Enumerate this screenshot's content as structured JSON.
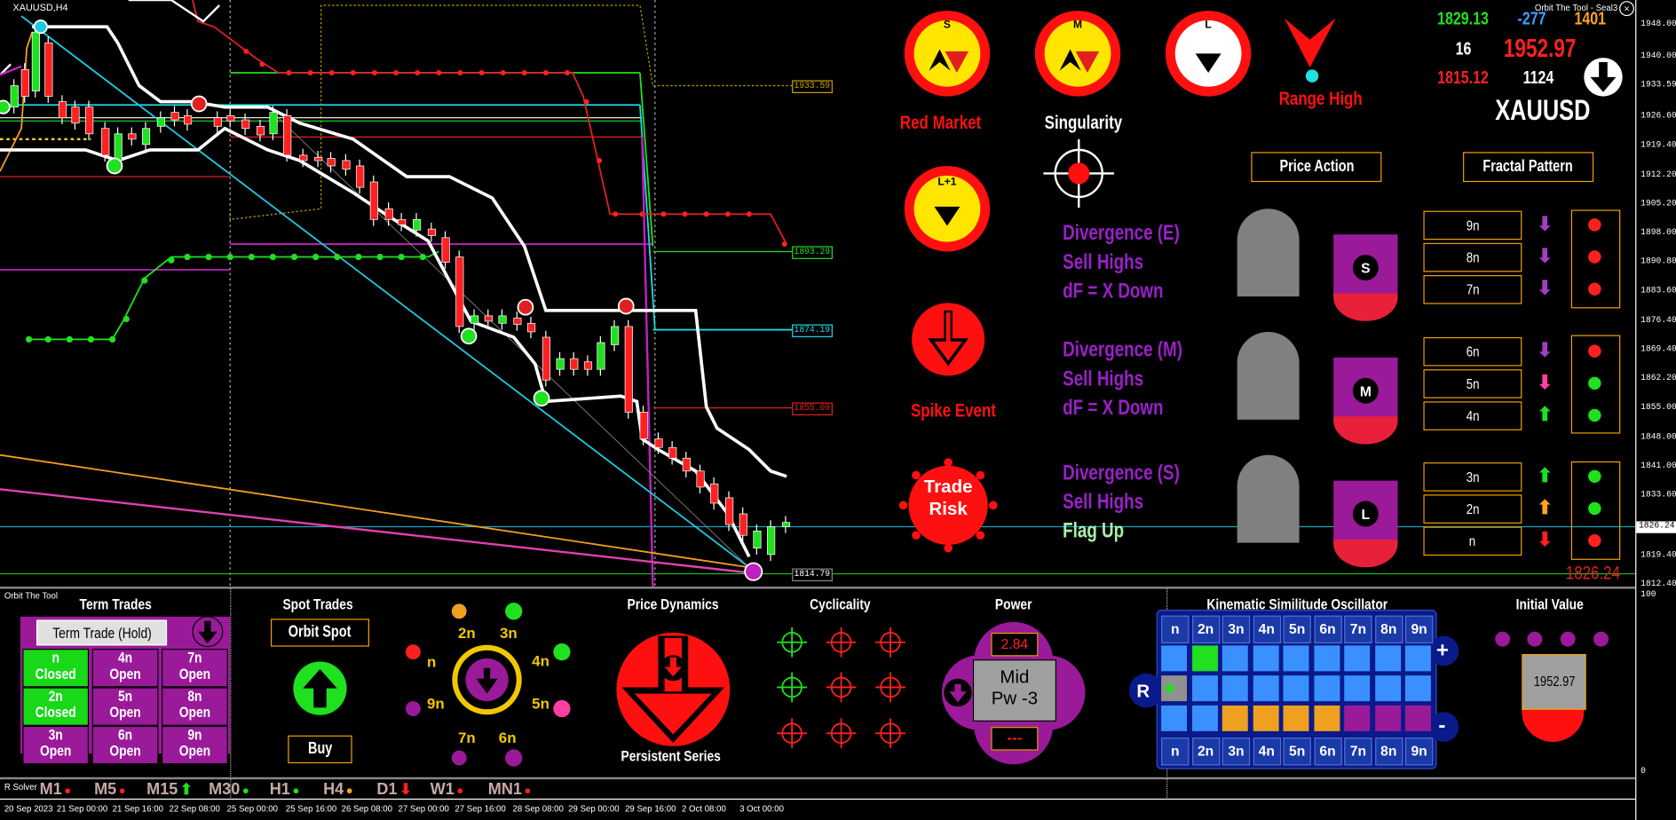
{
  "window": {
    "symbol_title": "XAUUSD,H4",
    "indicator_title": "Orbit The Tool - Seal3",
    "panel_title": "Orbit The Tool",
    "solver_label": "R Solver"
  },
  "top_stats": {
    "v1": "1829.13",
    "v2": "-277",
    "v3": "1401",
    "v4": "16",
    "v5": "1952.97",
    "v6": "1815.12",
    "v7": "1124",
    "symbol": "XAUUSD"
  },
  "price_axis": {
    "labels": [
      "1948.00",
      "1940.00",
      "1933.59",
      "1926.60",
      "1919.40",
      "1912.20",
      "1905.20",
      "1898.00",
      "1890.80",
      "1883.60",
      "1876.40",
      "1869.40",
      "1862.20",
      "1855.00",
      "1848.00",
      "1841.00",
      "1833.60",
      "1826.24",
      "1819.40",
      "1812.40"
    ],
    "current": "1826.24",
    "osc_top": "100",
    "osc_bottom": "0"
  },
  "levels": {
    "l1": "1933.59",
    "l2": "1893.29",
    "l3": "1874.19",
    "l4": "1855.09",
    "l5": "1814.79",
    "current_big": "1826.24"
  },
  "markets": {
    "s_letter": "S",
    "m_letter": "M",
    "l_letter": "L",
    "lplus_letter": "L+1",
    "red_market": "Red Market",
    "singularity": "Singularity",
    "range_high": "Range High",
    "spike_event": "Spike Event",
    "trade_risk_1": "Trade",
    "trade_risk_2": "Risk"
  },
  "divergence": [
    {
      "title": "Divergence (E)",
      "line2": "Sell Highs",
      "line3": "dF = X Down"
    },
    {
      "title": "Divergence (M)",
      "line2": "Sell Highs",
      "line3": "dF = X Down"
    },
    {
      "title": "Divergence (S)",
      "line2": "Sell Highs",
      "line3": "Flag Up"
    }
  ],
  "buttons": {
    "price_action": "Price Action",
    "fractal_pattern": "Fractal Pattern"
  },
  "fractal_rows": [
    {
      "label": "9n",
      "arrow": "⬇",
      "arrow_color": "#a040c0",
      "dot": "#ff2020"
    },
    {
      "label": "8n",
      "arrow": "⬇",
      "arrow_color": "#a040c0",
      "dot": "#ff2020"
    },
    {
      "label": "7n",
      "arrow": "⬇",
      "arrow_color": "#a040c0",
      "dot": "#ff2020"
    },
    {
      "label": "6n",
      "arrow": "⬇",
      "arrow_color": "#a040c0",
      "dot": "#ff2020"
    },
    {
      "label": "5n",
      "arrow": "⬇",
      "arrow_color": "#ff40a0",
      "dot": "#20e020"
    },
    {
      "label": "4n",
      "arrow": "⬆",
      "arrow_color": "#20e020",
      "dot": "#20e020"
    },
    {
      "label": "3n",
      "arrow": "⬆",
      "arrow_color": "#20e020",
      "dot": "#20e020"
    },
    {
      "label": "2n",
      "arrow": "⬆",
      "arrow_color": "#ffa020",
      "dot": "#20e020"
    },
    {
      "label": "n",
      "arrow": "⬇",
      "arrow_color": "#ff2020",
      "dot": "#ff2020"
    }
  ],
  "term_trades": {
    "title": "Term Trades",
    "button": "Term Trade (Hold)",
    "cells": [
      {
        "n": "n",
        "s": "Closed",
        "c": "#18d818"
      },
      {
        "n": "4n",
        "s": "Open",
        "c": "#9a1a9a"
      },
      {
        "n": "7n",
        "s": "Open",
        "c": "#9a1a9a"
      },
      {
        "n": "2n",
        "s": "Closed",
        "c": "#18d818"
      },
      {
        "n": "5n",
        "s": "Open",
        "c": "#9a1a9a"
      },
      {
        "n": "8n",
        "s": "Open",
        "c": "#9a1a9a"
      },
      {
        "n": "3n",
        "s": "Open",
        "c": "#9a1a9a"
      },
      {
        "n": "6n",
        "s": "Open",
        "c": "#9a1a9a"
      },
      {
        "n": "9n",
        "s": "Open",
        "c": "#9a1a9a"
      }
    ]
  },
  "spot_trades": {
    "title": "Spot Trades",
    "button": "Orbit Spot",
    "buy": "Buy"
  },
  "orbit": {
    "labels": [
      "2n",
      "3n",
      "4n",
      "5n",
      "6n",
      "7n",
      "9n",
      "n"
    ]
  },
  "price_dynamics": {
    "title": "Price Dynamics",
    "subtitle": "Persistent Series"
  },
  "cyclicality": {
    "title": "Cyclicality"
  },
  "power": {
    "title": "Power",
    "value": "2.84",
    "center_1": "Mid",
    "center_2": "Pw -3",
    "bottom": "---"
  },
  "kso": {
    "title": "Kinematic Similitude Oscillator",
    "headers": [
      "n",
      "2n",
      "3n",
      "4n",
      "5n",
      "6n",
      "7n",
      "8n",
      "9n"
    ],
    "plus": "+",
    "minus": "-",
    "r": "R"
  },
  "initial_value": {
    "title": "Initial Value",
    "value": "1952.97"
  },
  "timeframes": [
    {
      "label": "M1",
      "mark": "●",
      "color": "#ff2020"
    },
    {
      "label": "M5",
      "mark": "●",
      "color": "#ff2020"
    },
    {
      "label": "M15",
      "mark": "⬆",
      "color": "#20e020"
    },
    {
      "label": "M30",
      "mark": "●",
      "color": "#20e020"
    },
    {
      "label": "H1",
      "mark": "●",
      "color": "#20e020"
    },
    {
      "label": "H4",
      "mark": "●",
      "color": "#ffa020"
    },
    {
      "label": "D1",
      "mark": "⬇",
      "color": "#ff2020"
    },
    {
      "label": "W1",
      "mark": "●",
      "color": "#ff2020"
    },
    {
      "label": "MN1",
      "mark": "●",
      "color": "#ff2020"
    }
  ],
  "dates": [
    "20 Sep 2023",
    "21 Sep 00:00",
    "21 Sep 16:00",
    "22 Sep 08:00",
    "25 Sep 00:00",
    "25 Sep 16:00",
    "26 Sep 08:00",
    "27 Sep 00:00",
    "27 Sep 16:00",
    "28 Sep 08:00",
    "29 Sep 00:00",
    "29 Sep 16:00",
    "2 Oct 08:00",
    "3 Oct 00:00"
  ]
}
